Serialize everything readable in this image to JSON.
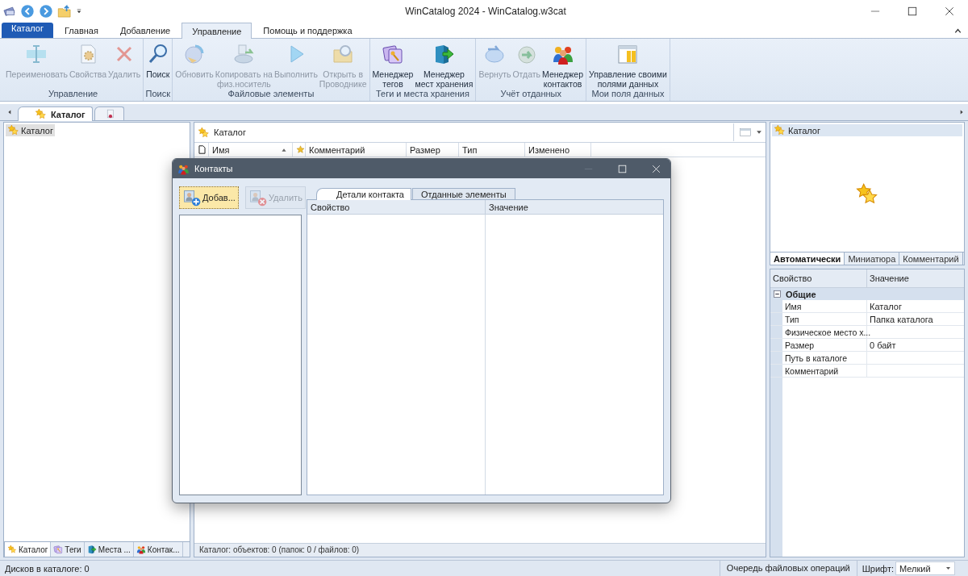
{
  "window": {
    "title": "WinCatalog 2024 - WinCatalog.w3cat"
  },
  "ribbon_tabs": [
    {
      "label": "Каталог",
      "kind": "app",
      "selected": false
    },
    {
      "label": "Главная",
      "kind": "tab",
      "selected": false
    },
    {
      "label": "Добавление",
      "kind": "tab",
      "selected": false
    },
    {
      "label": "Управление",
      "kind": "tab",
      "selected": true
    },
    {
      "label": "Помощь и поддержка",
      "kind": "tab",
      "selected": false
    }
  ],
  "ribbon_groups": [
    {
      "label": "Управление",
      "buttons": [
        {
          "label": "Переименовать",
          "kind": "rename",
          "disabled": true
        },
        {
          "label": "Свойства",
          "kind": "properties",
          "disabled": true
        },
        {
          "label": "Удалить",
          "kind": "delete",
          "disabled": true
        }
      ]
    },
    {
      "label": "Поиск",
      "buttons": [
        {
          "label": "Поиск",
          "kind": "search",
          "disabled": false
        }
      ]
    },
    {
      "label": "Файловые элементы",
      "buttons": [
        {
          "label": "Обновить",
          "kind": "refresh",
          "disabled": true
        },
        {
          "label": "Копировать на\nфиз.носитель",
          "kind": "copy",
          "disabled": true
        },
        {
          "label": "Выполнить",
          "kind": "run",
          "disabled": true
        },
        {
          "label": "Открыть в\nПроводнике",
          "kind": "open",
          "disabled": true
        }
      ]
    },
    {
      "label": "Теги и места хранения",
      "buttons": [
        {
          "label": "Менеджер\nтегов",
          "kind": "tags",
          "disabled": false
        },
        {
          "label": "Менеджер\nмест хранения",
          "kind": "locations",
          "disabled": false
        }
      ]
    },
    {
      "label": "Учёт отданных",
      "buttons": [
        {
          "label": "Вернуть",
          "kind": "return",
          "disabled": true
        },
        {
          "label": "Отдать",
          "kind": "give",
          "disabled": true
        },
        {
          "label": "Менеджер\nконтактов",
          "kind": "contacts",
          "disabled": false
        }
      ]
    },
    {
      "label": "Мои поля данных",
      "buttons": [
        {
          "label": "Управление своими\nполями данных",
          "kind": "fields",
          "disabled": false
        }
      ]
    }
  ],
  "document_tabs": [
    {
      "label": "Каталог",
      "kind": "catalog",
      "selected": true
    },
    {
      "kind": "locked",
      "selected": false
    }
  ],
  "tree": {
    "items": [
      {
        "label": "Каталог",
        "selected": true
      }
    ]
  },
  "left_tabs": [
    {
      "label": "Каталог",
      "kind": "catalog",
      "selected": true
    },
    {
      "label": "Теги",
      "kind": "tags",
      "selected": false
    },
    {
      "label": "Места ...",
      "kind": "locations",
      "selected": false
    },
    {
      "label": "Контак...",
      "kind": "contacts",
      "selected": false
    }
  ],
  "address_bar": {
    "path": "Каталог"
  },
  "file_list": {
    "columns": [
      {
        "kind": "icon"
      },
      {
        "kind": "text",
        "label": "Имя",
        "sorted": true
      },
      {
        "kind": "star"
      },
      {
        "kind": "text",
        "label": "Комментарий",
        "sorted": false
      },
      {
        "kind": "text",
        "label": "Размер",
        "sorted": false
      },
      {
        "kind": "text",
        "label": "Тип",
        "sorted": false
      },
      {
        "kind": "text",
        "label": "Изменено",
        "sorted": false
      }
    ],
    "status": "Каталог: объектов: 0 (папок: 0 / файлов: 0)"
  },
  "preview": {
    "title": "Каталог",
    "tabs": [
      {
        "label": "Автоматически",
        "selected": true
      },
      {
        "label": "Миниатюра",
        "selected": false
      },
      {
        "label": "Комментарий",
        "selected": false
      }
    ]
  },
  "properties": {
    "columns": [
      "Свойство",
      "Значение"
    ],
    "categories": [
      {
        "label": "Общие",
        "expanded": true,
        "rows": [
          {
            "name": "Имя",
            "value": "Каталог"
          },
          {
            "name": "Тип",
            "value": "Папка каталога"
          },
          {
            "name": "Физическое место х..."
          },
          {
            "name": "Размер",
            "value": "0 байт"
          },
          {
            "name": "Путь в каталоге"
          },
          {
            "name": "Комментарий"
          }
        ]
      }
    ]
  },
  "dialog": {
    "title": "Контакты",
    "buttons": [
      {
        "label": "Добав...",
        "kind": "add",
        "disabled": false,
        "focused": true
      },
      {
        "label": "Удалить",
        "kind": "remove",
        "disabled": true,
        "focused": false
      }
    ],
    "tabs": [
      {
        "label": "Детали контакта",
        "selected": true
      },
      {
        "label": "Отданные элементы",
        "selected": false
      }
    ],
    "columns": [
      "Свойство",
      "Значение"
    ]
  },
  "status_bar": {
    "disks": "Дисков в каталоге: 0",
    "queue": "Очередь файловых операций",
    "font_label": "Шрифт:",
    "font_value": "Мелкий"
  }
}
